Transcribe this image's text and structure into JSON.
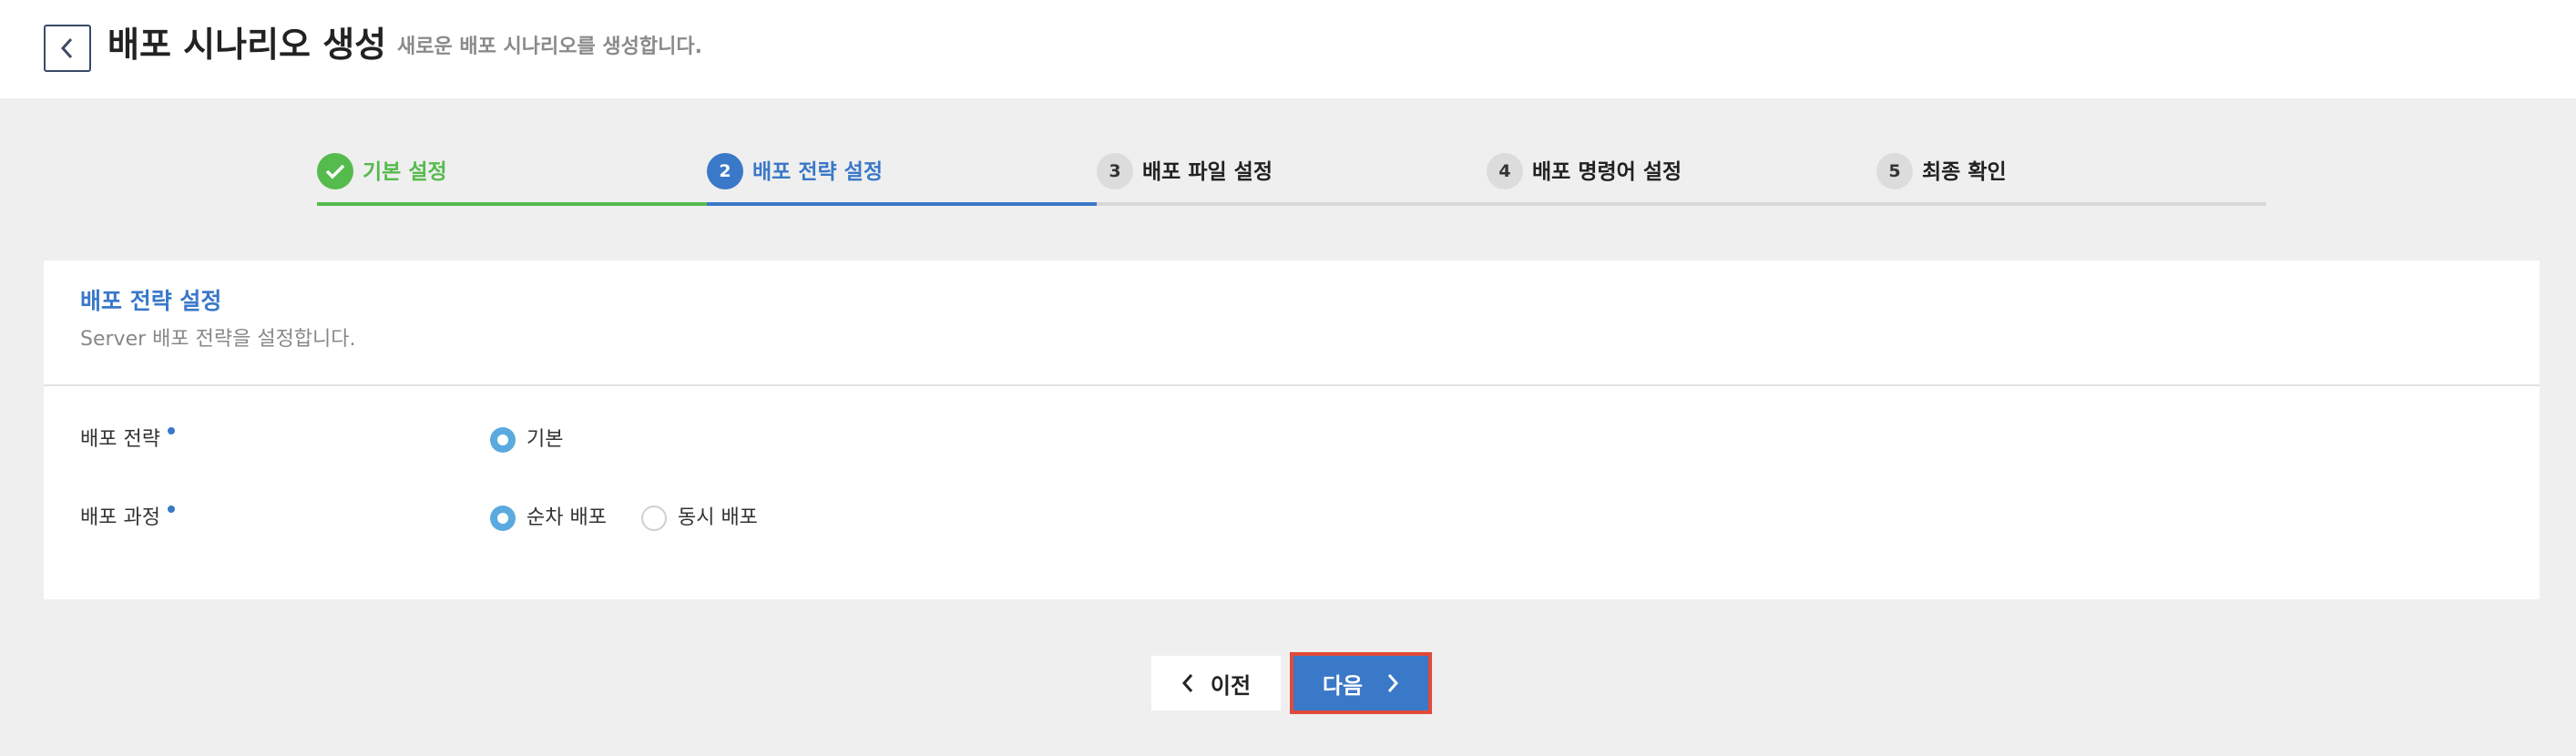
{
  "header": {
    "back_icon": "chevron-left-icon",
    "title": "배포 시나리오 생성",
    "subtitle": "새로운 배포 시나리오를 생성합니다."
  },
  "stepper": {
    "steps": [
      {
        "number": "1",
        "label": "기본 설정",
        "state": "done",
        "icon": "check-icon"
      },
      {
        "number": "2",
        "label": "배포 전략 설정",
        "state": "active"
      },
      {
        "number": "3",
        "label": "배포 파일 설정",
        "state": "pending"
      },
      {
        "number": "4",
        "label": "배포 명령어 설정",
        "state": "pending"
      },
      {
        "number": "5",
        "label": "최종 확인",
        "state": "pending"
      }
    ],
    "colors": {
      "done": "#55bb4d",
      "active": "#3a78c8",
      "pending": "#dcdcdc"
    }
  },
  "panel": {
    "title": "배포 전략 설정",
    "description": "Server 배포 전략을 설정합니다.",
    "fields": [
      {
        "label": "배포 전략",
        "required": true,
        "options": [
          {
            "label": "기본",
            "checked": true
          }
        ]
      },
      {
        "label": "배포 과정",
        "required": true,
        "options": [
          {
            "label": "순차 배포",
            "checked": true
          },
          {
            "label": "동시 배포",
            "checked": false
          }
        ]
      }
    ]
  },
  "footer": {
    "prev_label": "이전",
    "next_label": "다음",
    "prev_icon": "chevron-left-icon",
    "next_icon": "chevron-right-icon",
    "next_highlight_color": "#e04a3a"
  }
}
